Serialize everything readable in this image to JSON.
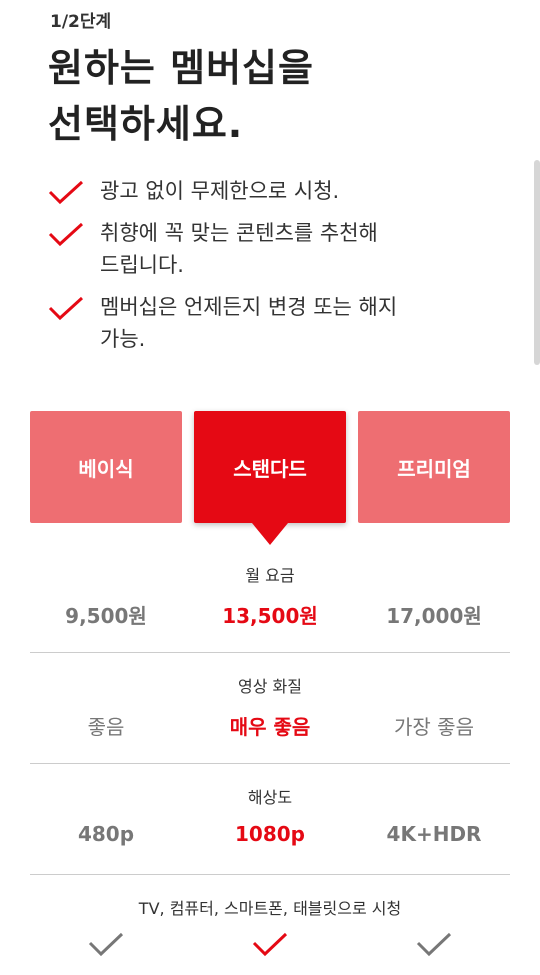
{
  "header": {
    "step": "1/2단계",
    "title_line1": "원하는 멤버십을",
    "title_line2": "선택하세요."
  },
  "benefits": [
    {
      "line1": "광고 없이 무제한으로 시청.",
      "line2": ""
    },
    {
      "line1": "취향에 꼭 맞는 콘텐츠를 추천해",
      "line2": "드립니다."
    },
    {
      "line1": "멤버십은 언제든지 변경 또는 해지",
      "line2": "가능."
    }
  ],
  "plans": {
    "selected": "스탠다드",
    "items": [
      {
        "label": "베이식"
      },
      {
        "label": "스탠다드"
      },
      {
        "label": "프리미엄"
      }
    ]
  },
  "comparison": {
    "price": {
      "label": "월 요금",
      "values": [
        "9,500원",
        "13,500원",
        "17,000원"
      ]
    },
    "quality": {
      "label": "영상 화질",
      "values": [
        "좋음",
        "매우 좋음",
        "가장 좋음"
      ]
    },
    "resolution": {
      "label": "해상도",
      "values": [
        "480p",
        "1080p",
        "4K+HDR"
      ]
    },
    "devices": {
      "label": "TV, 컴퓨터, 스마트폰, 태블릿으로 시청",
      "values": [
        true,
        true,
        true
      ]
    }
  },
  "colors": {
    "accent": "#e50914",
    "plan_inactive": "#ee6e72",
    "muted_value": "#777777"
  }
}
